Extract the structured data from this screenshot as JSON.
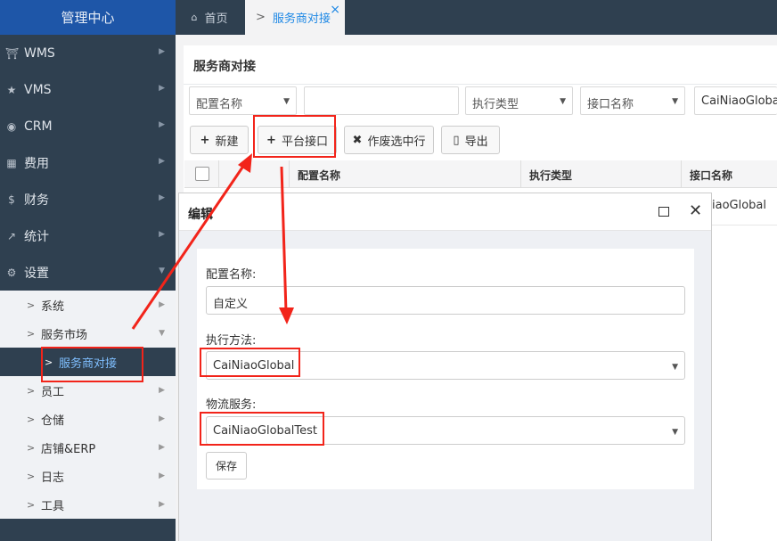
{
  "app": {
    "title": "管理中心"
  },
  "sidebar": {
    "menus": [
      {
        "label": "WMS",
        "icon": "bank-icon"
      },
      {
        "label": "VMS",
        "icon": "star-icon"
      },
      {
        "label": "CRM",
        "icon": "user-circle-icon"
      },
      {
        "label": "费用",
        "icon": "table-icon"
      },
      {
        "label": "财务",
        "icon": "dollar-icon"
      },
      {
        "label": "统计",
        "icon": "line-chart-icon"
      },
      {
        "label": "设置",
        "icon": "gear-icon"
      }
    ],
    "submenu": [
      "系统",
      "服务市场",
      "服务商对接",
      "员工",
      "仓储",
      "店铺&ERP",
      "日志",
      "工具"
    ]
  },
  "tabs": [
    {
      "label": "首页",
      "icon": "home-icon"
    },
    {
      "label": "服务商对接",
      "close": "×"
    }
  ],
  "page": {
    "title": "服务商对接",
    "filters": {
      "config_name": "配置名称",
      "blank": "",
      "exec_type": "执行类型",
      "interface_name": "接口名称",
      "value_truncated": "CaiNiaoGlobalT"
    },
    "toolbar": {
      "new": "新建",
      "platform_interface": "平台接口",
      "void_selected": "作废选中行",
      "export": "导出"
    },
    "table": {
      "headers": [
        "配置名称",
        "执行类型",
        "接口名称"
      ],
      "row_fragment": "iaoGlobal"
    }
  },
  "modal": {
    "title": "编辑",
    "fields": {
      "config_name_label": "配置名称:",
      "config_name_value": "自定义",
      "exec_method_label": "执行方法:",
      "exec_method_value": "CaiNiaoGlobal",
      "logistics_label": "物流服务:",
      "logistics_value": "CaiNiaoGlobalTest"
    },
    "save": "保存"
  },
  "colors": {
    "sidebar": "#2f4050",
    "logo": "#1e56a8",
    "highlight": "#f2241a",
    "accent": "#1e88e5"
  }
}
